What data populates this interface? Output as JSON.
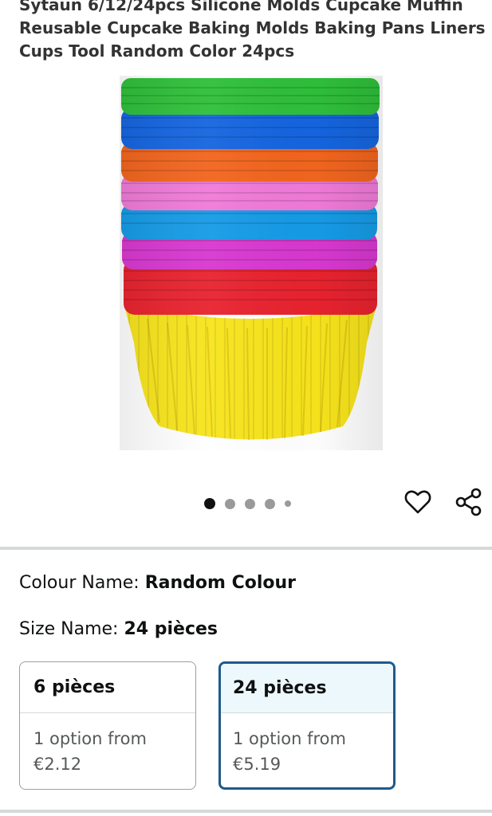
{
  "product": {
    "title": "Sytaun 6/12/24pcs Silicone Molds Cupcake Muffin Reusable Cupcake Baking Molds Baking Pans Liners Cups Tool Random Color 24pcs",
    "image_alt": "Stack of colorful silicone cupcake liners",
    "image_colors": [
      "#2fbf3a",
      "#1565e0",
      "#f2651e",
      "#f07ad8",
      "#169be6",
      "#d838d0",
      "#e8232f",
      "#f7e41c"
    ]
  },
  "carousel": {
    "total_images": 5,
    "active_index": 0
  },
  "icons": {
    "favorite": "heart-icon",
    "share": "share-icon"
  },
  "attributes": {
    "colour_label": "Colour Name:",
    "colour_value": "Random Colour",
    "size_label": "Size Name:",
    "size_value": "24 pièces"
  },
  "size_options": [
    {
      "name": "6 pièces",
      "line1": "1 option from",
      "price": "€2.12",
      "selected": false
    },
    {
      "name": "24 pièces",
      "line1": "1 option from",
      "price": "€5.19",
      "selected": true
    }
  ],
  "colors": {
    "selected_border": "#1e5a8c",
    "selected_header_bg": "#edf8fc",
    "divider": "#d5d9d9"
  }
}
